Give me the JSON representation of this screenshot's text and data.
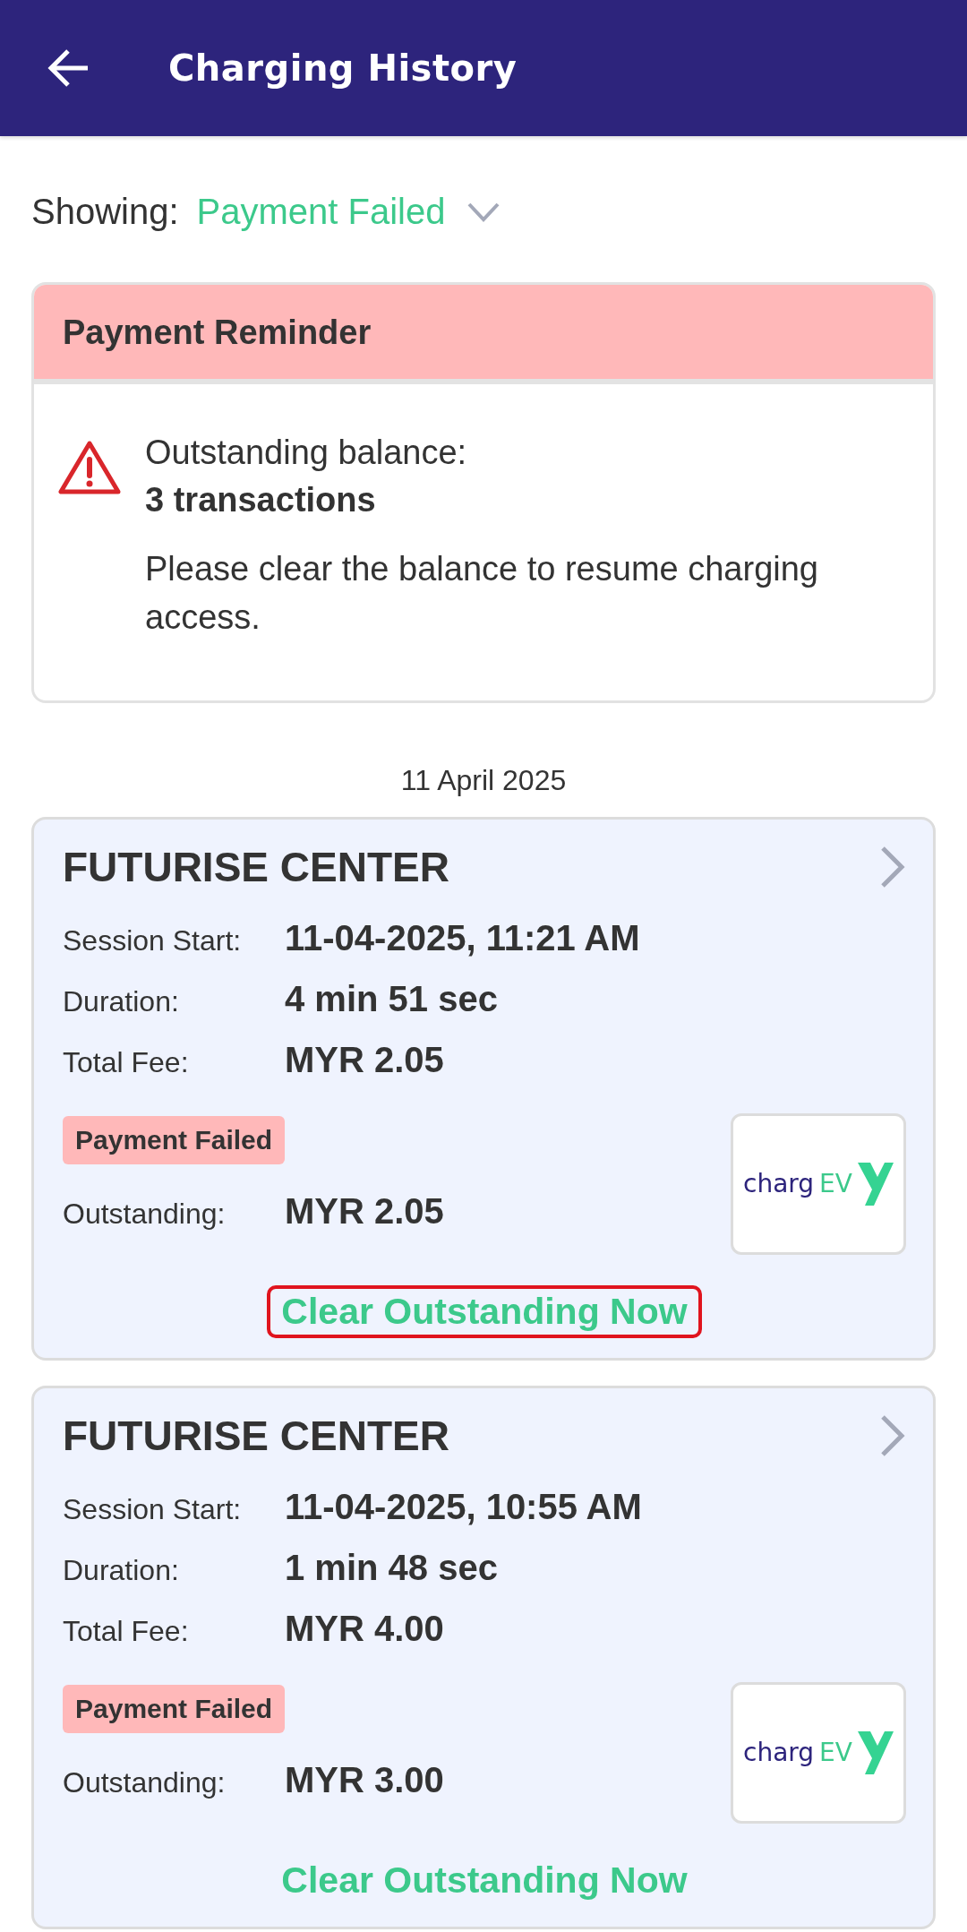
{
  "header": {
    "title": "Charging History"
  },
  "filter": {
    "label": "Showing:",
    "value": "Payment Failed"
  },
  "reminder": {
    "title": "Payment Reminder",
    "balance_label": "Outstanding balance:",
    "balance_value": "3 transactions",
    "message": "Please clear the balance to resume charging access."
  },
  "date": "11 April 2025",
  "sessions": [
    {
      "site": "FUTURISE CENTER",
      "fields": [
        {
          "label": "Session Start:",
          "value": "11-04-2025, 11:21 AM"
        },
        {
          "label": "Duration:",
          "value": "4 min 51 sec"
        },
        {
          "label": "Total Fee:",
          "value": "MYR 2.05"
        }
      ],
      "status": "Payment Failed",
      "outstanding_label": "Outstanding:",
      "outstanding_value": "MYR 2.05",
      "logo": {
        "part_a": "charg",
        "part_b": "EV"
      },
      "action": "Clear Outstanding Now",
      "highlighted": true
    },
    {
      "site": "FUTURISE CENTER",
      "fields": [
        {
          "label": "Session Start:",
          "value": "11-04-2025, 10:55 AM"
        },
        {
          "label": "Duration:",
          "value": "1 min 48 sec"
        },
        {
          "label": "Total Fee:",
          "value": "MYR 4.00"
        }
      ],
      "status": "Payment Failed",
      "outstanding_label": "Outstanding:",
      "outstanding_value": "MYR 3.00",
      "logo": {
        "part_a": "charg",
        "part_b": "EV"
      },
      "action": "Clear Outstanding Now",
      "highlighted": false
    }
  ]
}
